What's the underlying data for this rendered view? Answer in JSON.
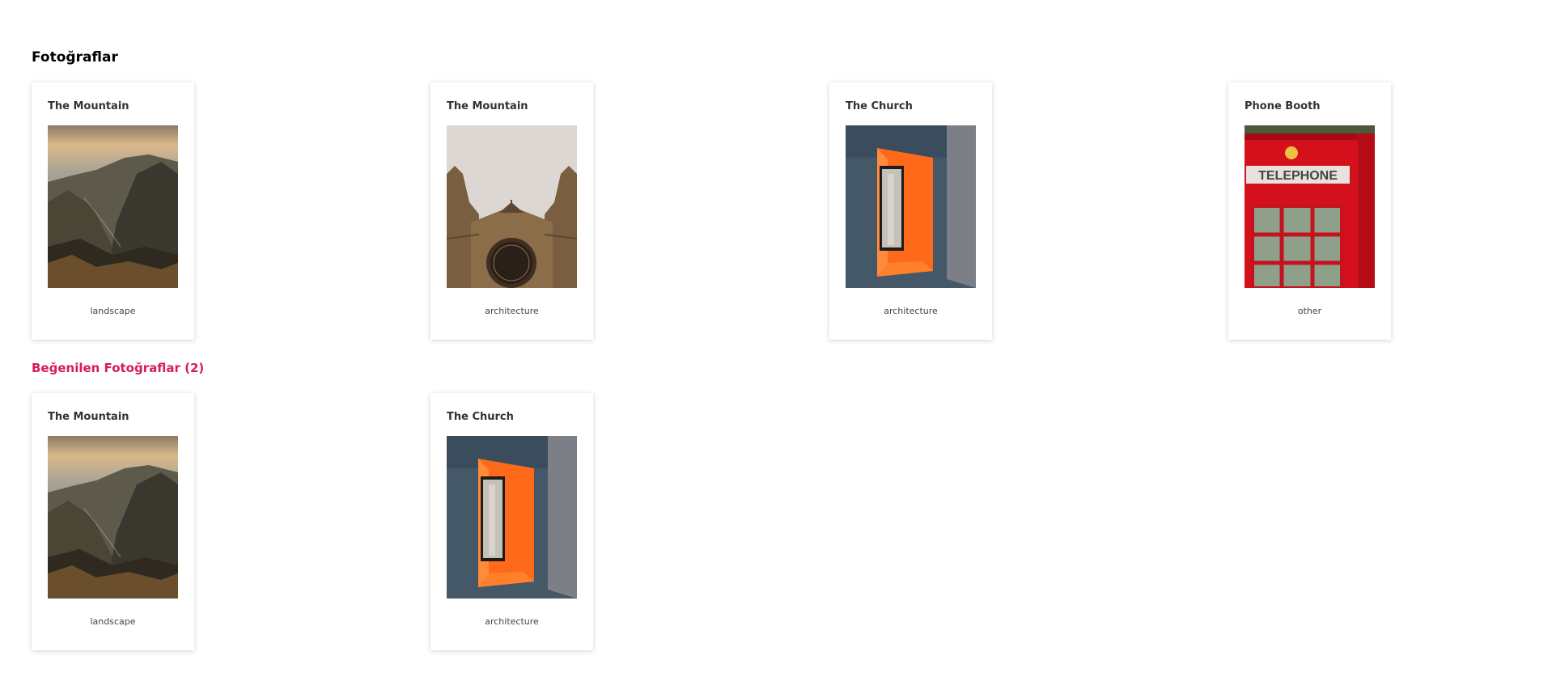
{
  "sections": {
    "all": {
      "title": "Fotoğraflar",
      "cards": [
        {
          "title": "The Mountain",
          "tag": "landscape",
          "image": "mountain-photo"
        },
        {
          "title": "The Mountain",
          "tag": "architecture",
          "image": "cathedral-photo"
        },
        {
          "title": "The Church",
          "tag": "architecture",
          "image": "orange-window-photo"
        },
        {
          "title": "Phone Booth",
          "tag": "other",
          "image": "telephone-booth-photo"
        }
      ]
    },
    "liked": {
      "title": "Beğenilen Fotoğraflar (2)",
      "title_color": "#d81b60",
      "cards": [
        {
          "title": "The Mountain",
          "tag": "landscape",
          "image": "mountain-photo"
        },
        {
          "title": "The Church",
          "tag": "architecture",
          "image": "orange-window-photo"
        }
      ]
    }
  }
}
